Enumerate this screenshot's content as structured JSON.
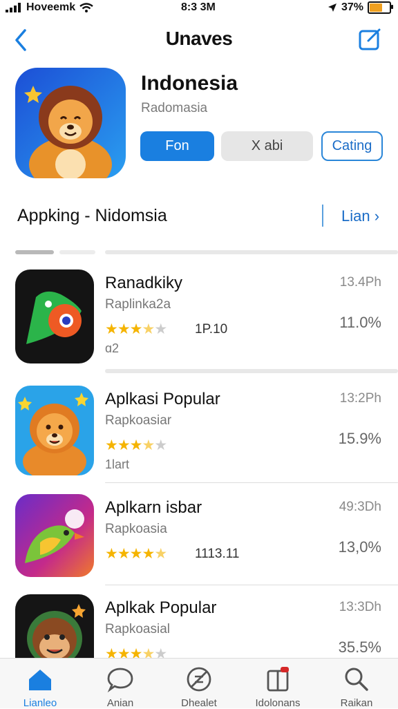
{
  "status_bar": {
    "carrier": "Hoveemk",
    "time": "8:3 3M",
    "battery": "37%",
    "icons": [
      "signal-icon",
      "wifi-icon",
      "location-icon",
      "battery-icon"
    ]
  },
  "nav": {
    "title": "Unaves",
    "back_icon": "chevron-left-icon",
    "action_icon": "compose-icon"
  },
  "hero": {
    "title": "Indonesia",
    "subtitle": "Radomasia",
    "buttons": {
      "primary": "Fon",
      "secondary": "X abi",
      "outline": "Cating"
    }
  },
  "section": {
    "heading": "Appking - Nidomsia",
    "more_label": "Lian"
  },
  "apps": [
    {
      "name": "Ranadkiky",
      "developer": "Raplinka2a",
      "rating": 3.5,
      "rating_count": "1P.10",
      "extra": "ɑ2",
      "time": "13.4Ph",
      "size": "11.0%",
      "icon": "parrot-app-icon"
    },
    {
      "name": "Aplkasi Popular",
      "developer": "Rapkoasiar",
      "rating": 3.5,
      "rating_count": "",
      "extra": "1lart",
      "time": "13:2Ph",
      "size": "15.9%",
      "icon": "lion-app-icon"
    },
    {
      "name": "Aplkarn isbar",
      "developer": "Rapkoasia",
      "rating": 4.5,
      "rating_count": "1113.11",
      "extra": "",
      "time": "49:3Dh",
      "size": "13,0%",
      "icon": "bird-app-icon"
    },
    {
      "name": "Aplkak Popular",
      "developer": "Rapkoasial",
      "rating": 3.5,
      "rating_count": "",
      "extra": "",
      "time": "13:3Dh",
      "size": "35.5%",
      "icon": "monkey-app-icon"
    }
  ],
  "tabs": [
    {
      "label": "Lianleo",
      "icon": "home-icon",
      "active": true
    },
    {
      "label": "Anian",
      "icon": "chat-icon",
      "active": false
    },
    {
      "label": "Dhealet",
      "icon": "block-icon",
      "active": false
    },
    {
      "label": "Idolonans",
      "icon": "updates-icon",
      "active": false
    },
    {
      "label": "Raikan",
      "icon": "search-icon",
      "active": false
    }
  ],
  "colors": {
    "accent": "#1a7fe0",
    "star": "#f5b400",
    "badge": "#d62828"
  }
}
